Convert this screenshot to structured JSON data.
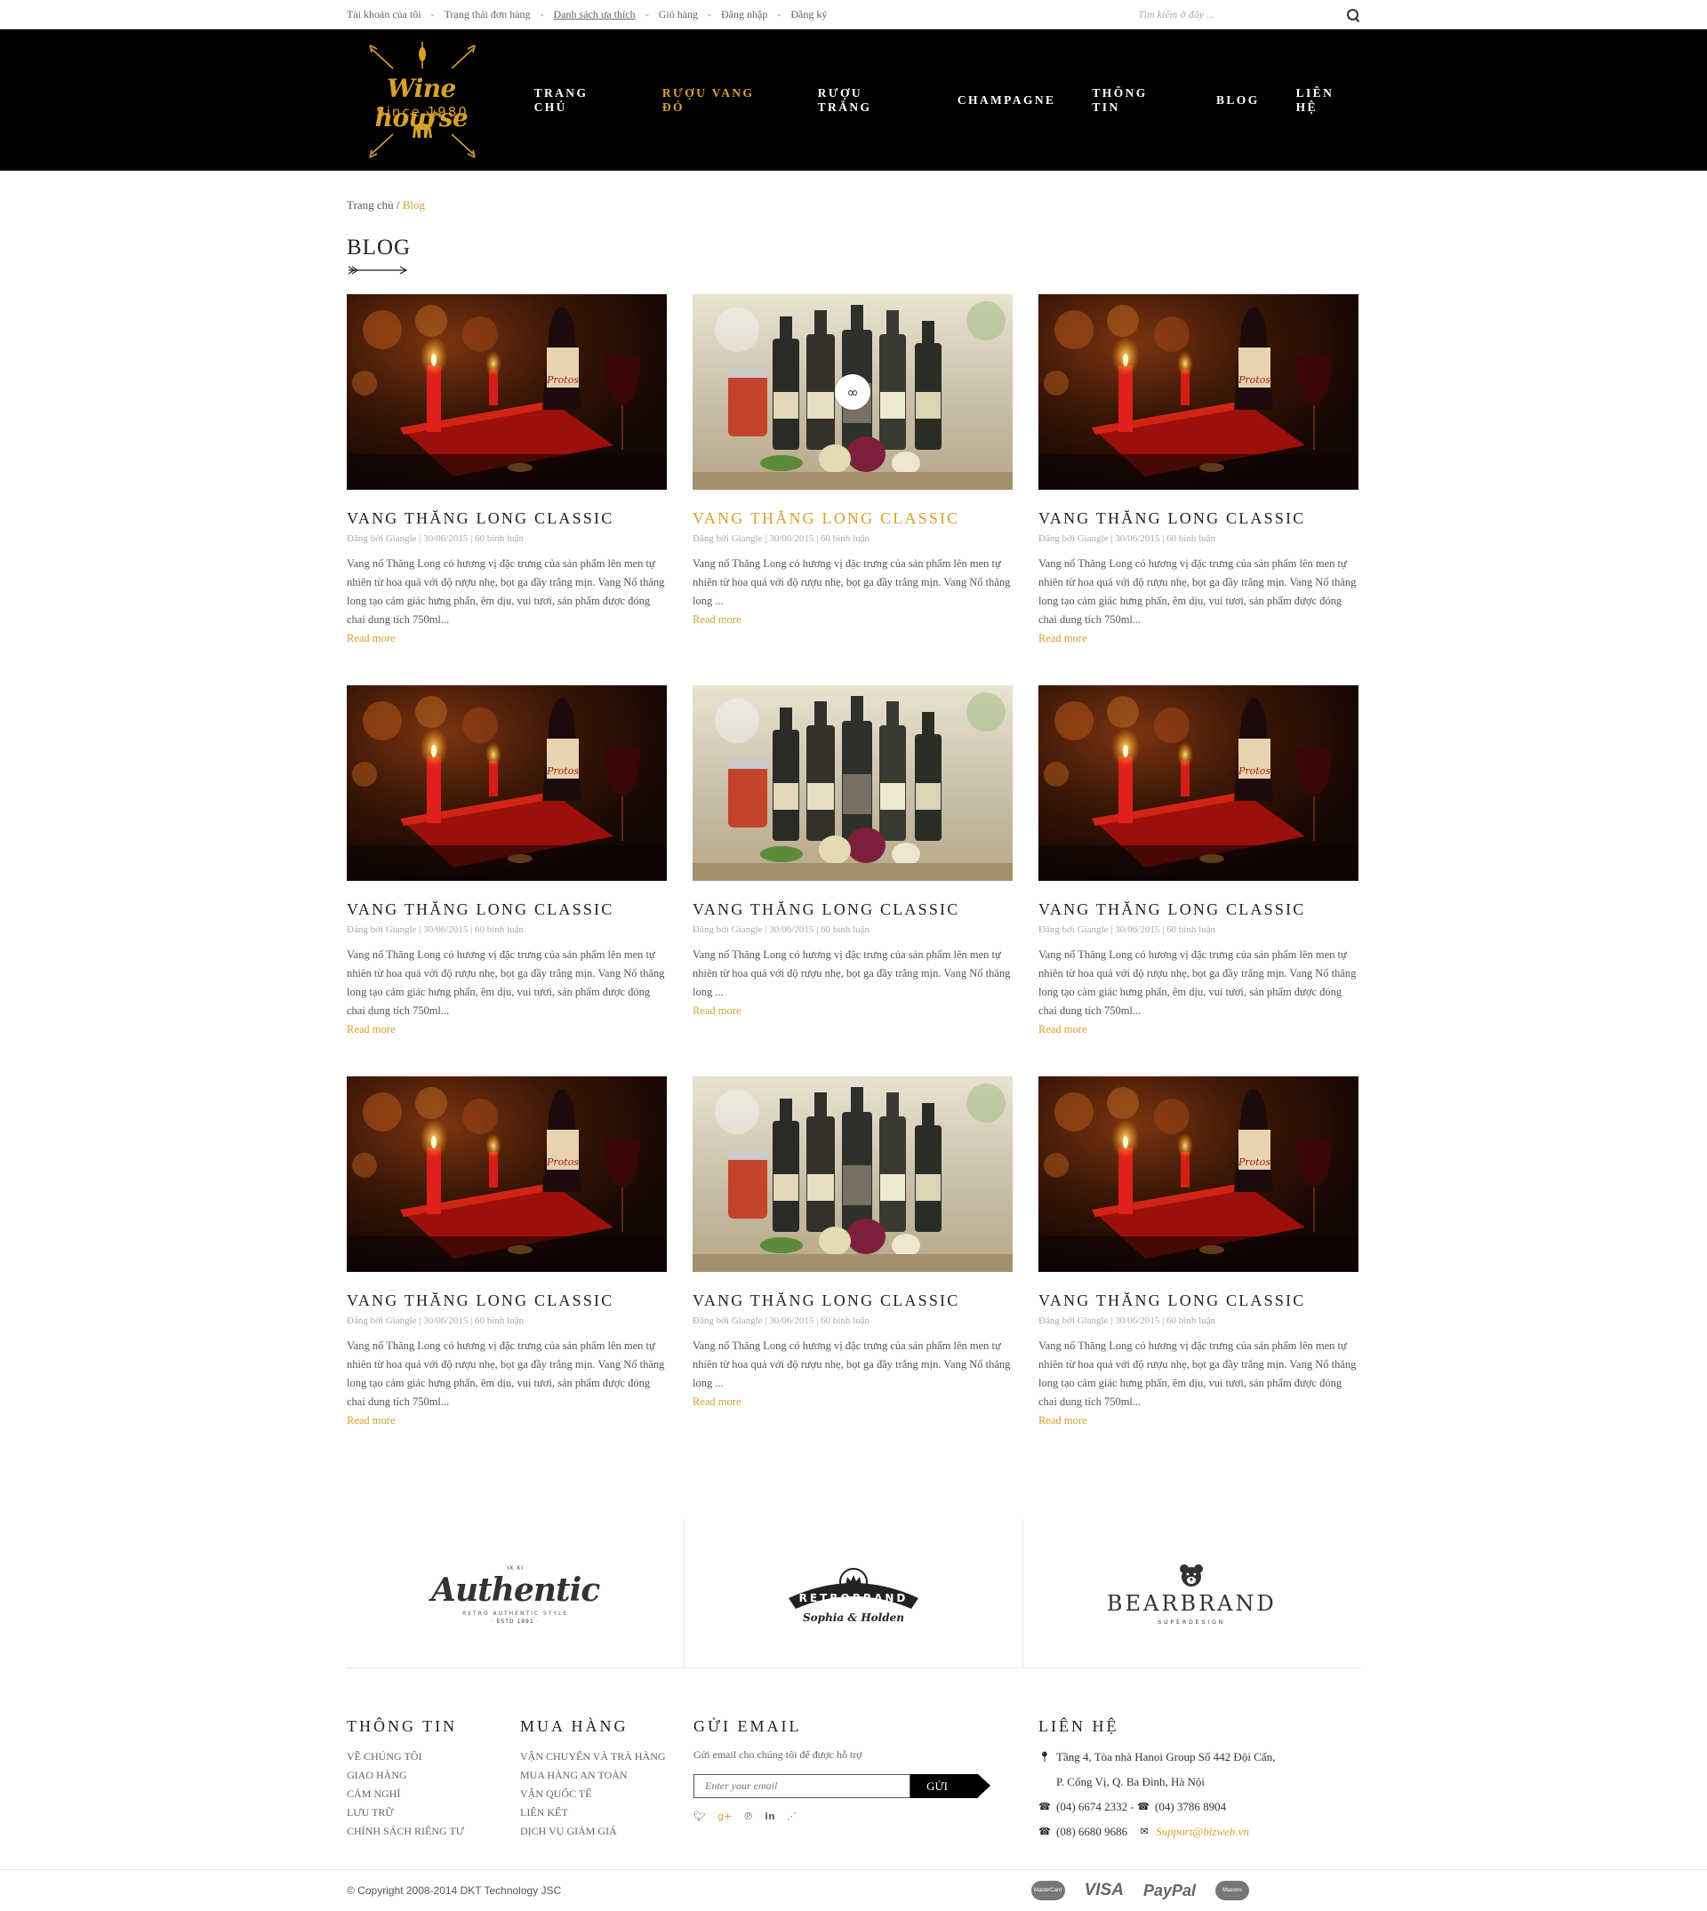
{
  "topbar": {
    "links": [
      "Tài khoản của tôi",
      "Trạng thái đơn hàng",
      "Danh sách ưa thích",
      "Giỏ hàng",
      "Đăng nhập",
      "Đăng ký"
    ],
    "separator": "-",
    "search_placeholder": "Tìm kiếm ở đây ..."
  },
  "logo": {
    "title": "Wine hourse",
    "since": "Since 1980"
  },
  "nav": {
    "items": [
      "TRANG CHỦ",
      "RƯỢU VANG ĐỎ",
      "RƯỢU TRẮNG",
      "CHAMPAGNE",
      "THÔNG TIN",
      "BLOG",
      "LIÊN HỆ"
    ],
    "active": "RƯỢU VANG ĐỎ"
  },
  "breadcrumb": {
    "home": "Trang chủ",
    "sep": " / ",
    "current": "Blog"
  },
  "page_title": "BLOG",
  "posts": [
    {
      "title": "VANG THĂNG LONG CLASSIC",
      "meta": "Đăng bởi Giangle | 30/06/2015 | 60 bình luận",
      "desc": "Vang nổ Thăng Long có hương vị đặc trưng của sản phẩm lên men tự nhiên từ hoa quả với độ rượu nhẹ, bọt ga đầy trắng mịn. Vang Nổ thăng long tạo cảm giác hưng phấn, êm dịu, vui tươi, sản phẩm được đóng chai dung tích 750ml...",
      "more": "Read more",
      "image": "candle-wine"
    },
    {
      "title": "VANG THĂNG LONG CLASSIC",
      "meta": "Đăng bởi Giangle | 30/06/2015 | 60 bình luận",
      "desc": "Vang nổ Thăng Long có hương vị đặc trưng của sản phẩm lên men tự nhiên từ hoa quả với độ rượu nhẹ, bọt ga đầy trắng mịn. Vang Nổ thăng long ...",
      "more": "Read more",
      "image": "bottles-table"
    },
    {
      "title": "VANG THĂNG LONG CLASSIC",
      "meta": "Đăng bởi Giangle | 30/06/2015 | 60 bình luận",
      "desc": "Vang nổ Thăng Long có hương vị đặc trưng của sản phẩm lên men tự nhiên từ hoa quả với độ rượu nhẹ, bọt ga đầy trắng mịn. Vang Nổ thăng long tạo cảm giác hưng phấn, êm dịu, vui tươi, sản phẩm được đóng chai dung tích 750ml...",
      "more": "Read more",
      "image": "candle-wine"
    },
    {
      "title": "VANG THĂNG LONG CLASSIC",
      "meta": "Đăng bởi Giangle | 30/06/2015 | 60 bình luận",
      "desc": "Vang nổ Thăng Long có hương vị đặc trưng của sản phẩm lên men tự nhiên từ hoa quả với độ rượu nhẹ, bọt ga đầy trắng mịn. Vang Nổ thăng long tạo cảm giác hưng phấn, êm dịu, vui tươi, sản phẩm được đóng chai dung tích 750ml...",
      "more": "Read more",
      "image": "candle-wine"
    },
    {
      "title": "VANG THĂNG LONG CLASSIC",
      "meta": "Đăng bởi Giangle | 30/06/2015 | 60 bình luận",
      "desc": "Vang nổ Thăng Long có hương vị đặc trưng của sản phẩm lên men tự nhiên từ hoa quả với độ rượu nhẹ, bọt ga đầy trắng mịn. Vang Nổ thăng long ...",
      "more": "Read more",
      "image": "bottles-table"
    },
    {
      "title": "VANG THĂNG LONG CLASSIC",
      "meta": "Đăng bởi Giangle | 30/06/2015 | 60 bình luận",
      "desc": "Vang nổ Thăng Long có hương vị đặc trưng của sản phẩm lên men tự nhiên từ hoa quả với độ rượu nhẹ, bọt ga đầy trắng mịn. Vang Nổ thăng long tạo cảm giác hưng phấn, êm dịu, vui tươi, sản phẩm được đóng chai dung tích 750ml...",
      "more": "Read more",
      "image": "candle-wine"
    },
    {
      "title": "VANG THĂNG LONG CLASSIC",
      "meta": "Đăng bởi Giangle | 30/06/2015 | 60 bình luận",
      "desc": "Vang nổ Thăng Long có hương vị đặc trưng của sản phẩm lên men tự nhiên từ hoa quả với độ rượu nhẹ, bọt ga đầy trắng mịn. Vang Nổ thăng long tạo cảm giác hưng phấn, êm dịu, vui tươi, sản phẩm được đóng chai dung tích 750ml...",
      "more": "Read more",
      "image": "candle-wine"
    },
    {
      "title": "VANG THĂNG LONG CLASSIC",
      "meta": "Đăng bởi Giangle | 30/06/2015 | 60 bình luận",
      "desc": "Vang nổ Thăng Long có hương vị đặc trưng của sản phẩm lên men tự nhiên từ hoa quả với độ rượu nhẹ, bọt ga đầy trắng mịn. Vang Nổ thăng long ...",
      "more": "Read more",
      "image": "bottles-table"
    },
    {
      "title": "VANG THĂNG LONG CLASSIC",
      "meta": "Đăng bởi Giangle | 30/06/2015 | 60 bình luận",
      "desc": "Vang nổ Thăng Long có hương vị đặc trưng của sản phẩm lên men tự nhiên từ hoa quả với độ rượu nhẹ, bọt ga đầy trắng mịn. Vang Nổ thăng long tạo cảm giác hưng phấn, êm dịu, vui tươi, sản phẩm được đóng chai dung tích 750ml...",
      "more": "Read more",
      "image": "candle-wine"
    }
  ],
  "brands": [
    {
      "name": "Authentic",
      "tag": "RETRO AUTHENTIC STYLE",
      "est": "· ESTD 1991 ·",
      "top": "IX  XI"
    },
    {
      "name": "RETROBRAND",
      "sub": "Sophia & Holden"
    },
    {
      "name": "BEARBRAND",
      "tag": "SUPERDESIGN"
    }
  ],
  "footer": {
    "info": {
      "title": "THÔNG TIN",
      "items": [
        "VỀ CHÚNG TÔI",
        "GIAO HÀNG",
        "CẢM NGHĨ",
        "LƯU TRỮ",
        "CHÍNH SÁCH RIÊNG TƯ"
      ]
    },
    "shop": {
      "title": "MUA HÀNG",
      "items": [
        "VẬN CHUYỂN VÀ TRẢ HÀNG",
        "MUA HÀNG AN TOÀN",
        "VẬN QUỐC TẾ",
        "LIÊN KẾT",
        "DỊCH VỤ GIẢM GIÁ"
      ]
    },
    "email": {
      "title": "GỬI EMAIL",
      "text": "Gửi email cho chúng tôi để được hỗ trợ",
      "placeholder": "Enter your email",
      "button": "GỬI",
      "social": [
        "twitter-icon",
        "google-plus-icon",
        "pinterest-icon",
        "linkedin-icon",
        "rss-icon"
      ]
    },
    "contact": {
      "title": "LIÊN HỆ",
      "address1": "Tầng 4, Tòa nhà Hanoi Group  Số 442 Đội Cấn,",
      "address2": "P. Cống Vị, Q. Ba Đình, Hà Nội",
      "phone1": "(04) 6674 2332",
      "phone_sep": " - ",
      "phone2": "(04) 3786 8904",
      "phone3": "(08) 6680 9686",
      "email": "Support@bizweb.vn"
    }
  },
  "copyright": "© Copyright 2008-2014 DKT Technology JSC",
  "payments": [
    "MasterCard",
    "VISA",
    "PayPal",
    "Maestro"
  ],
  "colors": {
    "accent": "#d6a12d",
    "header_bg": "#000000"
  }
}
